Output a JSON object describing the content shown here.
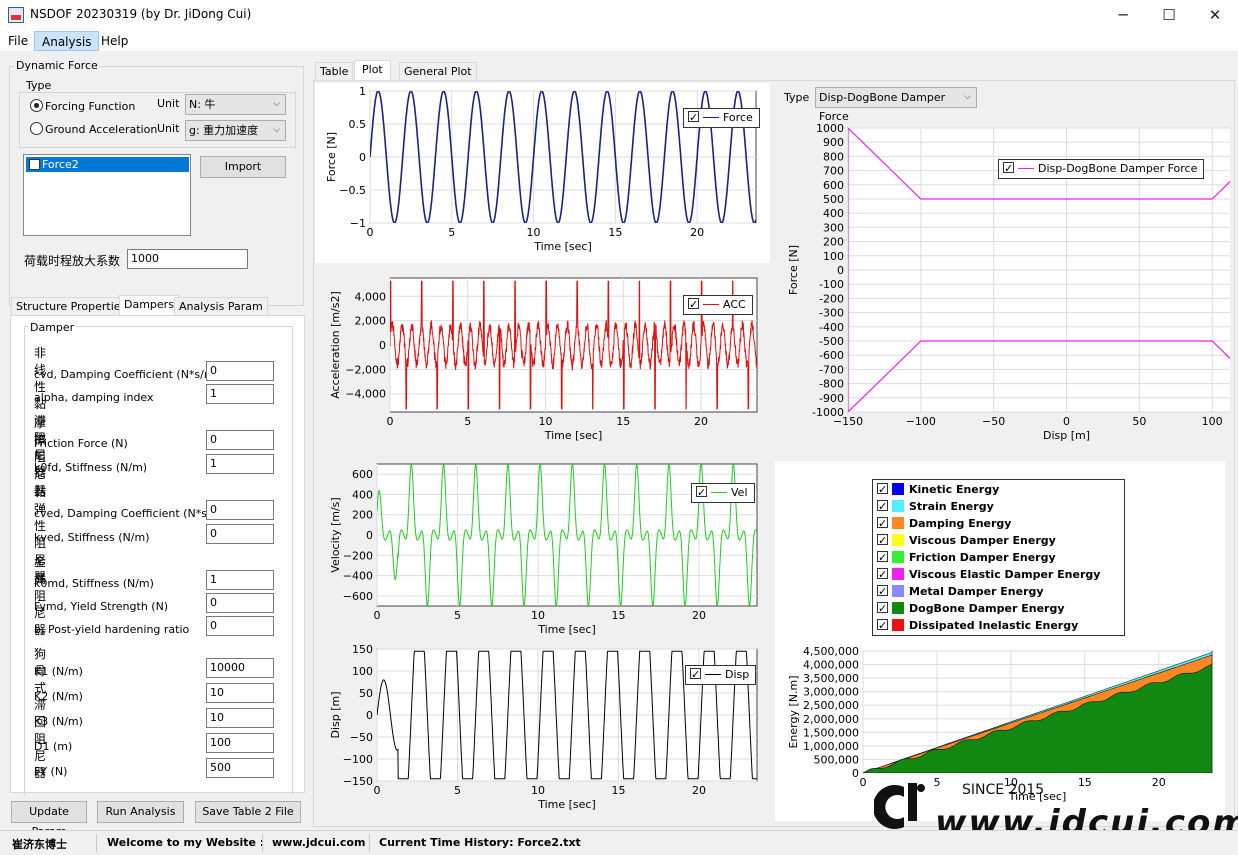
{
  "window": {
    "title": "NSDOF 20230319 (by Dr. JiDong Cui)",
    "minimize": "─",
    "maximize": "☐",
    "close": "✕"
  },
  "menu": {
    "file": "File",
    "analysis": "Analysis",
    "help": "Help"
  },
  "dynamic_force": {
    "group_label": "Dynamic Force",
    "type_label": "Type",
    "forcing_function": {
      "label": "Forcing Function",
      "unit_label": "Unit",
      "unit_value": "N: 牛",
      "selected": true
    },
    "ground_acceleration": {
      "label": "Ground Acceleration",
      "unit_label": "Unit",
      "unit_value": "g: 重力加速度",
      "selected": false
    },
    "list_items": [
      "Force2"
    ],
    "import_button": "Import",
    "amplification_label": "荷载时程放大系数",
    "amplification_value": "1000"
  },
  "left_tabs": {
    "structure": "Structure Properties",
    "dampers": "Dampers",
    "analysis": "Analysis Param"
  },
  "dampers": {
    "group_label": "Damper",
    "nonlinear_viscous": {
      "heading": "非线性黏滞阻尼器",
      "cvd_label": "cvd, Damping Coefficient (N*s/m)",
      "cvd_value": "0",
      "alpha_label": "alpha, damping index",
      "alpha_value": "1"
    },
    "friction": {
      "heading": "摩擦阻尼器",
      "force_label": "Friction Force (N)",
      "force_value": "0",
      "k0fd_label": "k0fd, Stiffness (N/m)",
      "k0fd_value": "1"
    },
    "viscoelastic": {
      "heading": "黏弹性阻尼器",
      "cved_label": "cved, Damping Coefficient (N*s/m)",
      "cved_value": "0",
      "kved_label": "kved, Stiffness (N/m)",
      "kved_value": "0"
    },
    "metal": {
      "heading": "金属阻尼器",
      "k0md_label": "k0md, Stiffness (N/m)",
      "k0md_value": "1",
      "fymd_label": "Fymd, Yield Strength (N)",
      "fymd_value": "0",
      "b_label": "b, Post-yield hardening ratio",
      "b_value": "0"
    },
    "dogbone": {
      "heading": "狗骨式滞回阻尼器",
      "k1_label": "K1  (N/m)",
      "k1_value": "10000",
      "k2_label": "K2  (N/m)",
      "k2_value": "10",
      "k3_label": "K3  (N/m)",
      "k3_value": "10",
      "d1_label": "D1  (m)",
      "d1_value": "100",
      "fy_label": "FY  (N)",
      "fy_value": "500"
    }
  },
  "buttons": {
    "update": "Update Param",
    "run": "Run Analysis",
    "save": "Save Table 2 File"
  },
  "main_tabs": {
    "table": "Table",
    "plot": "Plot",
    "general": "General Plot"
  },
  "type_selector": {
    "label": "Type",
    "value": "Disp-DogBone Damper Force"
  },
  "watermark": {
    "since": "SINCE 2015",
    "site": "www.jdcui.com"
  },
  "status": {
    "author": "崔济东博士",
    "welcome": "Welcome to my Website :",
    "site": "www.jdcui.com",
    "history": "Current Time History: Force2.txt"
  },
  "chart_data": [
    {
      "type": "line",
      "ylabel": "Force [N]",
      "xlabel": "Time [sec]",
      "xlim": [
        0,
        23.6
      ],
      "ylim": [
        -1,
        1
      ],
      "xticks": [
        0,
        5,
        10,
        15,
        20
      ],
      "yticks": [
        -1,
        -0.5,
        0,
        0.5,
        1
      ],
      "ytick_labels": [
        "−1",
        "−0.5",
        "0",
        "0.5",
        "1"
      ],
      "color": "#1a237e",
      "series": [
        {
          "name": "Force",
          "signal": "sine",
          "frequency_hz": 0.5,
          "amplitude": 1
        }
      ]
    },
    {
      "type": "line",
      "ylabel": "Acceleration [m/s2]",
      "xlabel": "Time [sec]",
      "xlim": [
        0,
        23.6
      ],
      "ylim": [
        -5500,
        5500
      ],
      "xticks": [
        0,
        5,
        10,
        15,
        20
      ],
      "yticks": [
        -4000,
        -2000,
        0,
        2000,
        4000
      ],
      "ytick_labels": [
        "−4,000",
        "−2,000",
        "0",
        "2,000",
        "4,000"
      ],
      "color": "#e01010",
      "series": [
        {
          "name": "ACC",
          "signal": "spiky",
          "amplitude": 5500
        }
      ]
    },
    {
      "type": "line",
      "ylabel": "Velocity [m/s]",
      "xlabel": "Time [sec]",
      "xlim": [
        0,
        23.6
      ],
      "ylim": [
        -700,
        700
      ],
      "xticks": [
        0,
        5,
        10,
        15,
        20
      ],
      "yticks": [
        -600,
        -400,
        -200,
        0,
        200,
        400,
        600
      ],
      "ytick_labels": [
        "−600",
        "−400",
        "−200",
        "0",
        "200",
        "400",
        "600"
      ],
      "color": "#22cc22",
      "series": [
        {
          "name": "Vel",
          "signal": "sharp",
          "amplitude": 650
        }
      ]
    },
    {
      "type": "line",
      "ylabel": "Disp [m]",
      "xlabel": "Time [sec]",
      "xlim": [
        0,
        23.6
      ],
      "ylim": [
        -150,
        150
      ],
      "xticks": [
        0,
        5,
        10,
        15,
        20
      ],
      "yticks": [
        -150,
        -100,
        -50,
        0,
        50,
        100,
        150
      ],
      "ytick_labels": [
        "−150",
        "−100",
        "−50",
        "0",
        "50",
        "100",
        "150"
      ],
      "color": "#000000",
      "series": [
        {
          "name": "Disp",
          "signal": "flat-top",
          "amplitude": 145
        }
      ]
    },
    {
      "type": "line",
      "ylabel": "Force [N]",
      "xlabel": "Disp [m]",
      "xlim": [
        -150,
        150
      ],
      "ylim": [
        -1000,
        1000
      ],
      "xticks": [
        -150,
        -100,
        -50,
        0,
        50,
        100,
        150
      ],
      "xtick_labels": [
        "−150",
        "−100",
        "−50",
        "0",
        "50",
        "100",
        "150"
      ],
      "yticks": [
        -1000,
        -900,
        -800,
        -700,
        -600,
        -500,
        -400,
        -300,
        -200,
        -100,
        0,
        100,
        200,
        300,
        400,
        500,
        600,
        700,
        800,
        900,
        1000
      ],
      "color": "#ee22ee",
      "series": [
        {
          "name": "Disp-DogBone Damper Force",
          "x": [
            -150,
            -100,
            100,
            150,
            150,
            100,
            -100,
            -150,
            -150
          ],
          "y": [
            -1000,
            -500,
            -500,
            -1000,
            1000,
            500,
            500,
            1000,
            -1000
          ]
        }
      ]
    },
    {
      "type": "area",
      "ylabel": "Energy [N.m]",
      "xlabel": "Time [sec]",
      "xlim": [
        0,
        23.6
      ],
      "ylim": [
        0,
        4500000
      ],
      "xticks": [
        0,
        5,
        10,
        15,
        20
      ],
      "yticks": [
        0,
        500000,
        1000000,
        1500000,
        2000000,
        2500000,
        3000000,
        3500000,
        4000000,
        4500000
      ],
      "ytick_labels": [
        "0",
        "500,000",
        "1,000,000",
        "1,500,000",
        "2,000,000",
        "2,500,000",
        "3,000,000",
        "3,500,000",
        "4,000,000",
        "4,500,000"
      ],
      "series": [
        {
          "name": "Kinetic Energy",
          "color": "#0000ee",
          "checked": true
        },
        {
          "name": "Strain Energy",
          "color": "#55eeff",
          "checked": true
        },
        {
          "name": "Damping Energy",
          "color": "#ff8822",
          "checked": true
        },
        {
          "name": "Viscous Damper Energy",
          "color": "#ffff11",
          "checked": true
        },
        {
          "name": "Friction Damper Energy",
          "color": "#33ee33",
          "checked": true
        },
        {
          "name": "Viscous Elastic Damper Energy",
          "color": "#ee22ee",
          "checked": true
        },
        {
          "name": "Metal Damper Energy",
          "color": "#8888ff",
          "checked": true
        },
        {
          "name": "DogBone Damper Energy",
          "color": "#118811",
          "checked": true
        },
        {
          "name": "Dissipated Inelastic Energy",
          "color": "#ee1111",
          "checked": true
        }
      ],
      "final_values": {
        "DogBone Damper Energy": 3950000,
        "Damping Energy": 4350000,
        "Strain Energy": 4450000
      }
    }
  ]
}
